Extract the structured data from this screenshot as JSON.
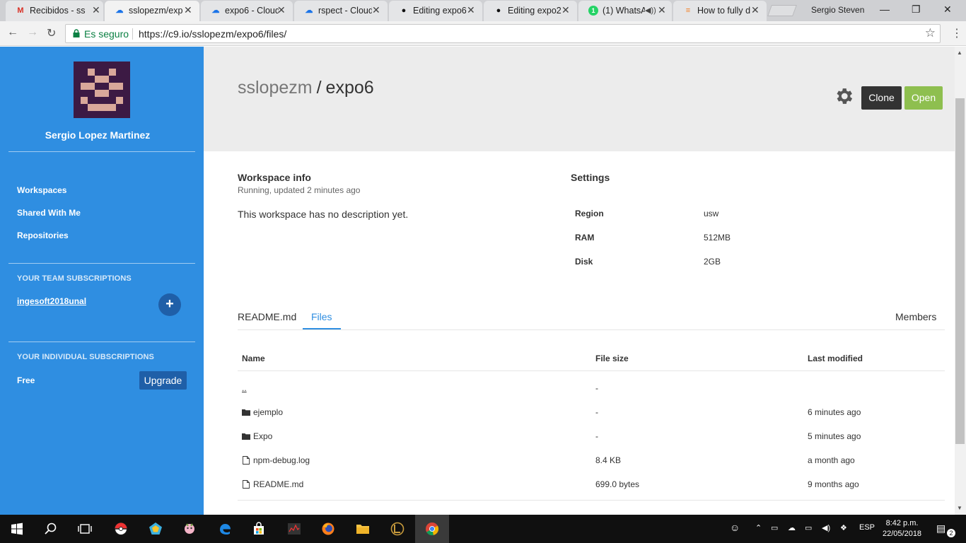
{
  "browser": {
    "tabs": [
      {
        "title": "Recibidos - ss",
        "icon": "gmail-icon"
      },
      {
        "title": "sslopezm/exp",
        "icon": "c9-icon"
      },
      {
        "title": "expo6 - Cloud",
        "icon": "c9-icon"
      },
      {
        "title": "rspect - Cloud",
        "icon": "c9-icon"
      },
      {
        "title": "Editing expo6",
        "icon": "github-icon"
      },
      {
        "title": "Editing expo2",
        "icon": "github-icon"
      },
      {
        "title": "(1) WhatsA",
        "icon": "whatsapp-icon"
      },
      {
        "title": "How to fully d",
        "icon": "stackoverflow-icon"
      }
    ],
    "profile_name": "Sergio Steven",
    "secure_label": "Es seguro",
    "url": "https://c9.io/sslopezm/expo6/files/"
  },
  "sidebar": {
    "user_name": "Sergio Lopez Martinez",
    "nav": [
      "Workspaces",
      "Shared With Me",
      "Repositories"
    ],
    "team_heading": "YOUR TEAM SUBSCRIPTIONS",
    "team_name": "ingesoft2018unal",
    "add_label": "+",
    "individual_heading": "YOUR INDIVIDUAL SUBSCRIPTIONS",
    "plan": "Free",
    "upgrade_label": "Upgrade"
  },
  "header": {
    "owner": "sslopezm",
    "separator": "/",
    "workspace": "expo6",
    "clone_label": "Clone",
    "open_label": "Open"
  },
  "workspace_info": {
    "title": "Workspace info",
    "status": "Running, updated 2 minutes ago",
    "description": "This workspace has no description yet."
  },
  "settings": {
    "title": "Settings",
    "rows": [
      {
        "label": "Region",
        "value": "usw"
      },
      {
        "label": "RAM",
        "value": "512MB"
      },
      {
        "label": "Disk",
        "value": "2GB"
      }
    ]
  },
  "tabs": {
    "readme": "README.md",
    "files": "Files",
    "members": "Members"
  },
  "files_table": {
    "headers": [
      "Name",
      "File size",
      "Last modified"
    ],
    "rows": [
      {
        "name": "..",
        "size": "-",
        "modified": "",
        "type": "parent"
      },
      {
        "name": "ejemplo",
        "size": "-",
        "modified": "6 minutes ago",
        "type": "folder"
      },
      {
        "name": "Expo",
        "size": "-",
        "modified": "5 minutes ago",
        "type": "folder"
      },
      {
        "name": "npm-debug.log",
        "size": "8.4 KB",
        "modified": "a month ago",
        "type": "file"
      },
      {
        "name": "README.md",
        "size": "699.0 bytes",
        "modified": "9 months ago",
        "type": "file"
      }
    ]
  },
  "taskbar": {
    "language": "ESP",
    "time": "8:42 p.m.",
    "date": "22/05/2018",
    "notifications": "2"
  },
  "colors": {
    "sidebar": "#2f8ee1",
    "accent": "#2f8ee1",
    "open_button": "#8ebf4f",
    "clone_button": "#333333"
  }
}
